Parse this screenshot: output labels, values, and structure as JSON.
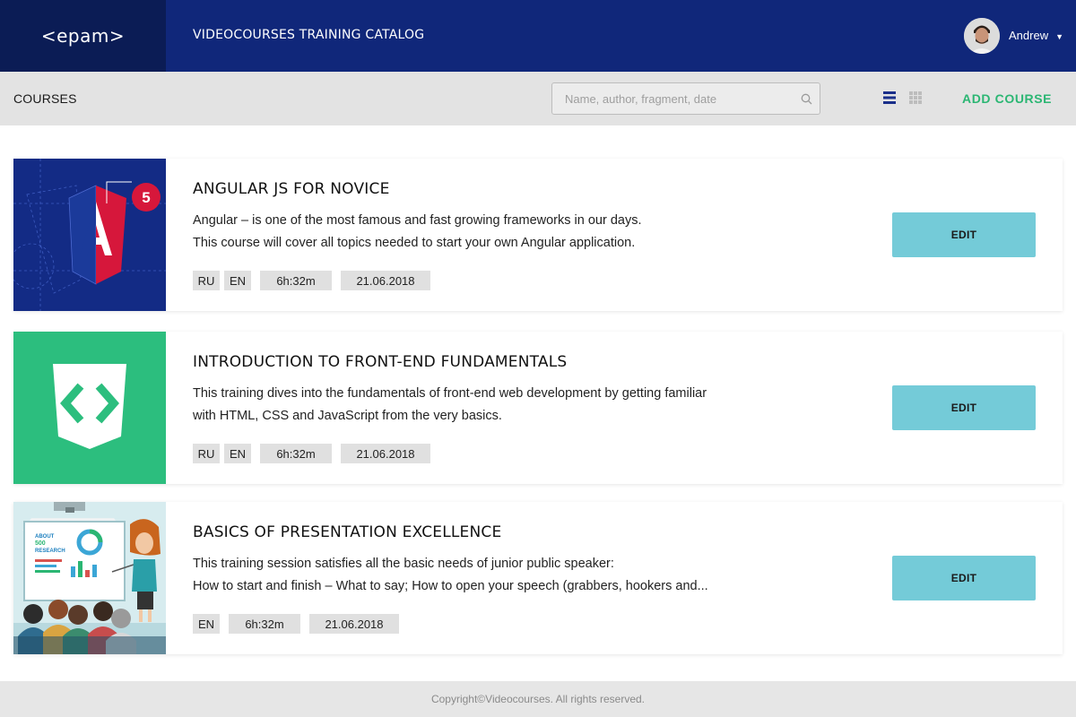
{
  "header": {
    "logo_text": "<epam>",
    "app_title": "VIDEOCOURSES TRAINING CATALOG",
    "user_name": "Andrew"
  },
  "toolbar": {
    "section_title": "COURSES",
    "search_placeholder": "Name, author, fragment, date",
    "add_course_label": "ADD COURSE"
  },
  "courses": [
    {
      "title": "ANGULAR JS FOR NOVICE",
      "description": [
        "Angular – is one of the most famous and fast growing frameworks in our days.",
        "This course will cover all topics needed to start your own Angular application."
      ],
      "languages": [
        "RU",
        "EN"
      ],
      "duration": "6h:32m",
      "date": "21.06.2018",
      "edit_label": "EDIT",
      "badge": "5"
    },
    {
      "title": "INTRODUCTION TO FRONT-END FUNDAMENTALS",
      "description": [
        "This training dives into the fundamentals of front-end web development by getting familiar",
        "with HTML, CSS and JavaScript from the very basics."
      ],
      "languages": [
        "RU",
        "EN"
      ],
      "duration": "6h:32m",
      "date": "21.06.2018",
      "edit_label": "EDIT"
    },
    {
      "title": "BASICS OF PRESENTATION EXCELLENCE",
      "description": [
        "This training session satisfies all the basic needs of junior public speaker:",
        "How to start and finish  – What to say; How to open your speech (grabbers, hookers and..."
      ],
      "languages": [
        "EN"
      ],
      "duration": "6h:32m",
      "date": "21.06.2018",
      "edit_label": "EDIT",
      "board_text": [
        "ABOUT",
        "500",
        "RESEARCH"
      ]
    }
  ],
  "footer": {
    "copyright": "Copyright©Videocourses. All rights reserved."
  },
  "colors": {
    "header_bg": "#10277a",
    "logo_bg": "#0b1c55",
    "accent_green": "#2bb673",
    "edit_button": "#74cbd8"
  },
  "icons": [
    "search-icon",
    "list-view-icon",
    "grid-view-icon",
    "chevron-down-icon",
    "code-brackets-icon"
  ]
}
